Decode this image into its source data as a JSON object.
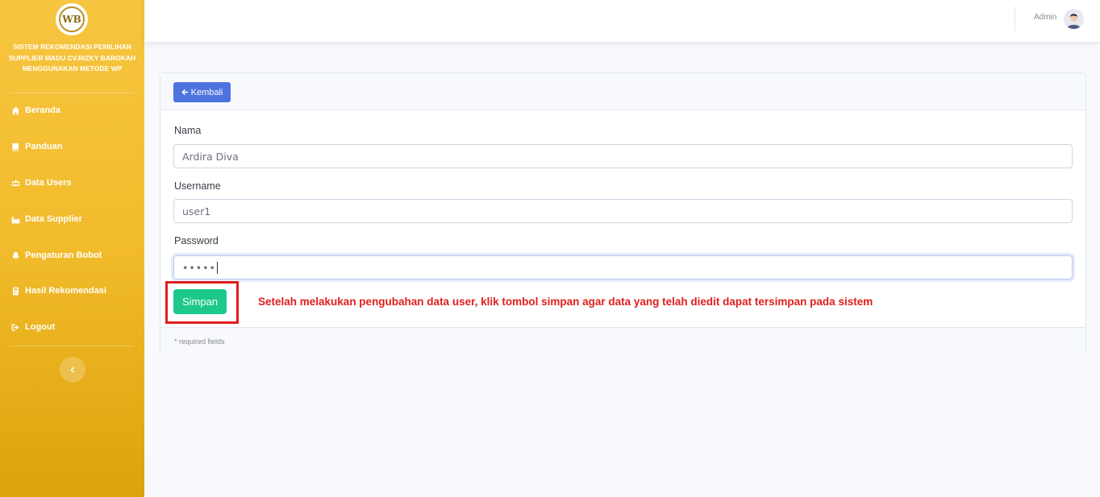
{
  "sidebar": {
    "logo_text": "WB",
    "brand": "SISTEM REKOMENDASI PEMILIHAN SUPPLIER MADU CV.RIZKY BAROKAH MENGGUNAKAN METODE WP",
    "items": [
      {
        "label": "Beranda",
        "icon": "home-icon"
      },
      {
        "label": "Panduan",
        "icon": "book-icon"
      },
      {
        "label": "Data Users",
        "icon": "users-icon"
      },
      {
        "label": "Data Supplier",
        "icon": "industry-icon"
      },
      {
        "label": "Pengaturan Bobot",
        "icon": "bell-icon"
      },
      {
        "label": "Hasil Rekomendasi",
        "icon": "calculator-icon"
      },
      {
        "label": "Logout",
        "icon": "sign-out-icon"
      }
    ]
  },
  "topbar": {
    "user_name": "Admin"
  },
  "card": {
    "back_label": "Kembali",
    "fields": {
      "nama": {
        "label": "Nama",
        "value": "Ardira Diva"
      },
      "username": {
        "label": "Username",
        "value": "user1"
      },
      "password": {
        "label": "Password",
        "value": "•••••"
      }
    },
    "save_label": "Simpan",
    "annotation": "Setelah melakukan pengubahan data user, klik tombol simpan agar data yang telah diedit dapat tersimpan pada sistem",
    "footer": "* required fields"
  },
  "colors": {
    "sidebar": "#f6c23e",
    "primary": "#4e73df",
    "success": "#1cc88a",
    "annotation": "#e11d1d"
  }
}
